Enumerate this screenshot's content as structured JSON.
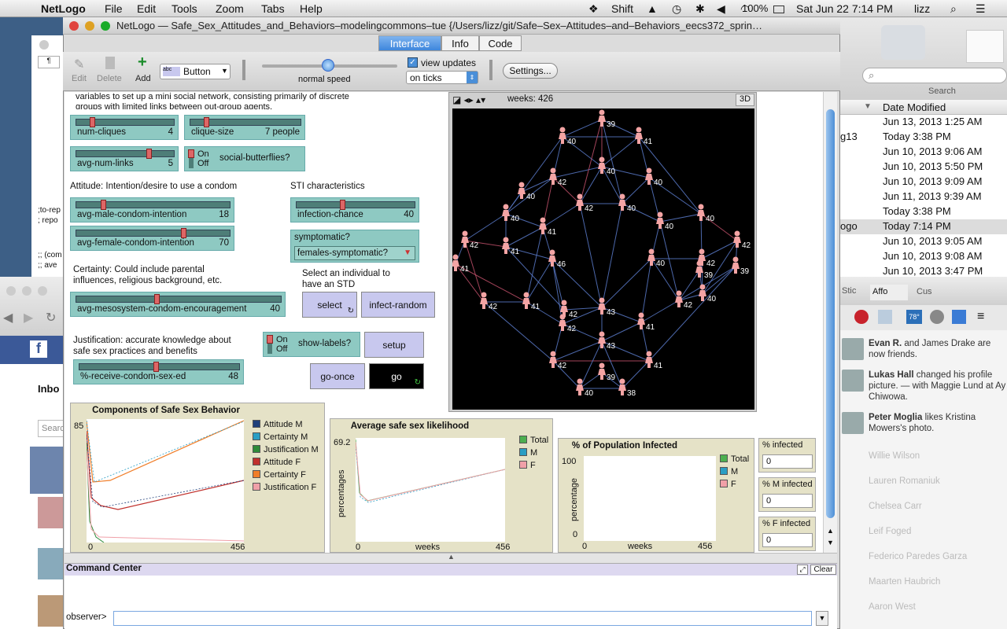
{
  "menubar": {
    "app": "NetLogo",
    "items": [
      "File",
      "Edit",
      "Tools",
      "Zoom",
      "Tabs",
      "Help"
    ],
    "status": {
      "shift": "Shift",
      "battery": "100%",
      "datetime": "Sat Jun 22  7:14 PM",
      "user": "lizz"
    }
  },
  "window": {
    "title": "NetLogo — Safe_Sex_Attitudes_and_Behaviors–modelingcommons–tue {/Users/lizz/git/Safe–Sex–Attitudes–and–Behaviors_eecs372_sprin…",
    "tabs": [
      "Interface",
      "Info",
      "Code"
    ],
    "active_tab": "Interface"
  },
  "toolbar": {
    "edit": "Edit",
    "delete": "Delete",
    "add": "Add",
    "widget_type": "Button",
    "speed_label": "normal speed",
    "view_updates": "view updates",
    "update_mode": "on ticks",
    "settings": "Settings..."
  },
  "interface": {
    "intro": "variables to set up a mini social network, consisting primarily of discrete groups with limited links between out-group agents.",
    "sliders": [
      {
        "name": "num-cliques",
        "value": "4",
        "fraction": 0.15
      },
      {
        "name": "clique-size",
        "value": "7 people",
        "fraction": 0.15
      },
      {
        "name": "avg-num-links",
        "value": "5",
        "fraction": 0.8
      },
      {
        "name": "avg-male-condom-intention",
        "value": "18",
        "fraction": 0.18
      },
      {
        "name": "avg-female-condom-intention",
        "value": "70",
        "fraction": 0.7
      },
      {
        "name": "infection-chance",
        "value": "40",
        "fraction": 0.4
      },
      {
        "name": "avg-mesosystem-condom-encouragement",
        "value": "40",
        "fraction": 0.4
      },
      {
        "name": "%-receive-condom-sex-ed",
        "value": "48",
        "fraction": 0.48
      }
    ],
    "switch_on": "On",
    "switch_off": "Off",
    "social_butterflies": "social-butterflies?",
    "show_labels": "show-labels?",
    "attitude_label": "Attitude:  Intention/desire to use a condom",
    "sti_label": "STI characteristics",
    "certainty_label": "Certainty: Could include parental influences, religious background, etc.",
    "select_label": "Select an individual to have an STD",
    "justification_label": "Justification: accurate knowledge about safe sex practices and benefits",
    "symptomatic_name": "symptomatic?",
    "symptomatic_value": "females-symptomatic?",
    "buttons": {
      "select": "select",
      "infect_random": "infect-random",
      "setup": "setup",
      "go_once": "go-once",
      "go": "go"
    },
    "world": {
      "ticks_label": "weeks: 426",
      "three_d": "3D"
    }
  },
  "plots": {
    "components": {
      "title": "Components of Safe Sex Behavior",
      "ymax": "85",
      "xmin": "0",
      "xmax": "456",
      "legend": [
        {
          "name": "Attitude M",
          "color": "#1f3f7a"
        },
        {
          "name": "Certainty M",
          "color": "#2a9ec4"
        },
        {
          "name": "Justification M",
          "color": "#2e8b3a"
        },
        {
          "name": "Attitude F",
          "color": "#c0302c"
        },
        {
          "name": "Certainty F",
          "color": "#f07d28"
        },
        {
          "name": "Justification F",
          "color": "#f0a0a8"
        }
      ]
    },
    "average": {
      "title": "Average safe sex likelihood",
      "ymax": "69.2",
      "xmin": "0",
      "xmax": "456",
      "xlabel": "weeks",
      "ylabel": "percentages",
      "legend": [
        {
          "name": "Total",
          "color": "#4caf50"
        },
        {
          "name": "M",
          "color": "#2a9ec4"
        },
        {
          "name": "F",
          "color": "#f0a0a8"
        }
      ]
    },
    "infected": {
      "title": "% of Population Infected",
      "ymax": "100",
      "ymin": "0",
      "xmin": "0",
      "xmax": "456",
      "xlabel": "weeks",
      "ylabel": "percentage",
      "legend": [
        {
          "name": "Total",
          "color": "#4caf50"
        },
        {
          "name": "M",
          "color": "#2a9ec4"
        },
        {
          "name": "F",
          "color": "#f0a0a8"
        }
      ]
    }
  },
  "monitors": [
    {
      "name": "% infected",
      "value": "0"
    },
    {
      "name": "% M infected",
      "value": "0"
    },
    {
      "name": "% F infected",
      "value": "0"
    }
  ],
  "command_center": {
    "title": "Command Center",
    "clear": "Clear",
    "prompt": "observer>"
  },
  "finder": {
    "search_label": "Search",
    "column": "Date Modified",
    "rows": [
      {
        "name": "",
        "date": "Jun 13, 2013 1:25 AM"
      },
      {
        "name": "g13",
        "date": "Today 3:38 PM"
      },
      {
        "name": "",
        "date": "Jun 10, 2013 9:06 AM"
      },
      {
        "name": "",
        "date": "Jun 10, 2013 5:50 PM"
      },
      {
        "name": "",
        "date": "Jun 10, 2013 9:09 AM"
      },
      {
        "name": "",
        "date": "Jun 11, 2013 9:39 AM"
      },
      {
        "name": "",
        "date": "Today 3:38 PM"
      },
      {
        "name": "ogo",
        "date": "Today 7:14 PM"
      },
      {
        "name": "",
        "date": "Jun 10, 2013 9:05 AM"
      },
      {
        "name": "",
        "date": "Jun 10, 2013 9:08 AM"
      },
      {
        "name": "",
        "date": "Jun 10, 2013 3:47 PM"
      }
    ]
  },
  "facebook": {
    "tabs": [
      "Stic",
      "Affo",
      "Cus"
    ],
    "weather": "78°",
    "feed": [
      {
        "bold": "Evan R.",
        "text": " and James Drake are now friends."
      },
      {
        "bold": "Lukas Hall",
        "text": " changed his profile picture. — with Maggie Lund at Ay Chiwowa."
      },
      {
        "bold": "Peter Moglia",
        "text": " likes Kristina Mowers's photo."
      }
    ],
    "friends": [
      "Willie Wilson",
      "Lauren Romaniuk",
      "Chelsea Carr",
      "Leif Foged",
      "Federico Paredes Garza",
      "Maarten Haubrich",
      "Aaron West"
    ]
  },
  "left_browser": {
    "inbox": "Inbo",
    "search": "Searc"
  },
  "code_snippets": [
    ";to-rep",
    ";  repo",
    ";; (com",
    ";; ave"
  ],
  "agents": [
    "39",
    "40",
    "41",
    "42",
    "40",
    "40",
    "40",
    "42",
    "40",
    "41",
    "40",
    "40",
    "42",
    "41",
    "46",
    "40",
    "42",
    "42",
    "41",
    "39",
    "40",
    "42",
    "43",
    "42",
    "41",
    "41",
    "42",
    "43",
    "42",
    "41",
    "40",
    "38",
    "42",
    "39",
    "39",
    "40"
  ]
}
